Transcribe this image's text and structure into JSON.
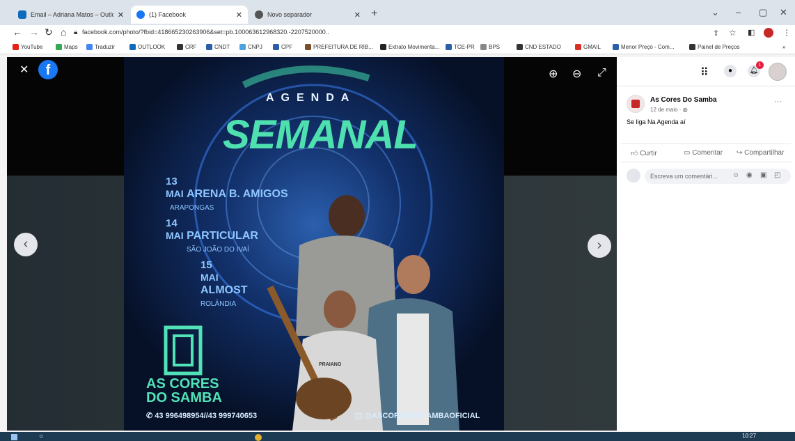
{
  "tabs": [
    {
      "title": "Email – Adriana Matos – Outlook",
      "color": "#0f6cbd",
      "active": false
    },
    {
      "title": "(1) Facebook",
      "color": "#1877f2",
      "active": true
    },
    {
      "title": "Novo separador",
      "color": "#555555",
      "active": false
    }
  ],
  "new_tab_label": "+",
  "window_controls": {
    "minimize": "–",
    "restore": "▢",
    "close": "✕",
    "menu": "⌄"
  },
  "address_bar": {
    "url": "facebook.com/photo/?fbid=418665230263906&set=pb.100063612968320.-2207520000.."
  },
  "bookmarks": [
    {
      "label": "YouTube",
      "color": "#e62117"
    },
    {
      "label": "Maps",
      "color": "#34a853"
    },
    {
      "label": "Traduzir",
      "color": "#4285f4"
    },
    {
      "label": "OUTLOOK",
      "color": "#0f6cbd"
    },
    {
      "label": "CRF",
      "color": "#333333"
    },
    {
      "label": "CNDT",
      "color": "#2b5ea8"
    },
    {
      "label": "CNPJ",
      "color": "#4aa3df"
    },
    {
      "label": "CPF",
      "color": "#2b5ea8"
    },
    {
      "label": "PREFEITURA DE RIB...",
      "color": "#7a4f2a"
    },
    {
      "label": "Extrato Movimenta...",
      "color": "#222222"
    },
    {
      "label": "TCE-PR",
      "color": "#2b5ea8"
    },
    {
      "label": "BPS",
      "color": "#888888"
    },
    {
      "label": "CND ESTADO",
      "color": "#333333"
    },
    {
      "label": "GMAIL",
      "color": "#d93025"
    },
    {
      "label": "Menor Preço - Com...",
      "color": "#2b5ea8"
    },
    {
      "label": "Painel de Preços",
      "color": "#333333"
    }
  ],
  "viewer": {
    "close_label": "✕",
    "fb_letter": "f",
    "zoom_in": "⊕",
    "zoom_out": "⊖",
    "fullscreen": "⤢",
    "prev": "‹",
    "next": "›"
  },
  "poster": {
    "agenda": "AGENDA",
    "semanal": "SEMANAL",
    "events": [
      {
        "day": "13",
        "month": "MAI",
        "venue": "ARENA B. AMIGOS",
        "city": "ARAPONGAS"
      },
      {
        "day": "14",
        "month": "MAI",
        "venue": "PARTICULAR",
        "city": "SÃO JOÃO DO IVAÍ"
      },
      {
        "day": "15",
        "month": "MAI",
        "venue": "ALMOST",
        "city": "ROLÂNDIA"
      }
    ],
    "brand_top": "AS CORES",
    "brand_bottom": "DO SAMBA",
    "phones": "43 996498954//43 999740653",
    "instagram": "@ASCORESDOSAMBAOFICIAL",
    "shirt_text": "PRAIANO"
  },
  "side": {
    "author": "As Cores Do Samba",
    "meta": "12 de maio · ",
    "caption": "Se liga Na Agenda aí",
    "more": "···",
    "notification_count": "1",
    "actions": {
      "like": "Curtir",
      "comment": "Comentar",
      "share": "Compartilhar"
    },
    "comment_placeholder": "Escreva um comentári..."
  },
  "taskbar": {
    "time": "10:27"
  }
}
